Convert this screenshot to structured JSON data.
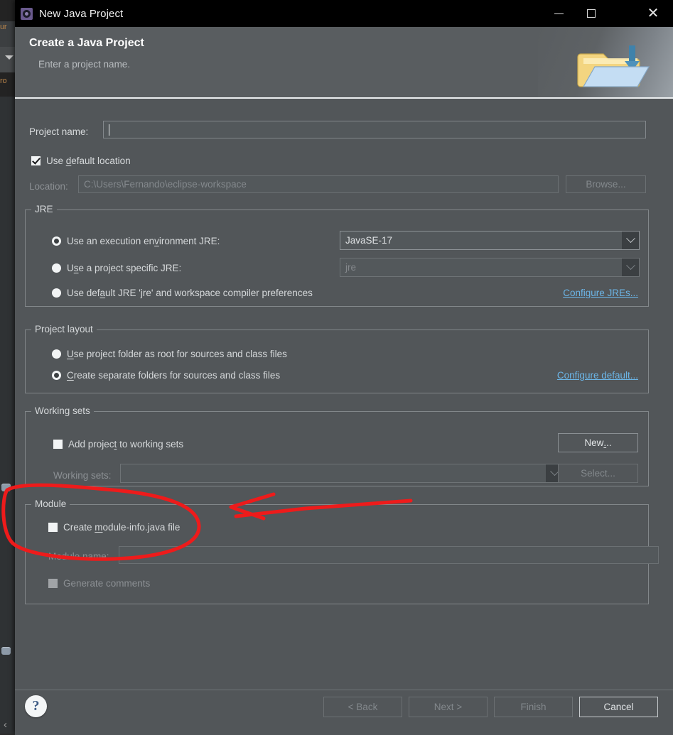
{
  "window": {
    "title": "New Java Project",
    "app_icon": "eclipse-gear-icon",
    "minimize": "—",
    "maximize": "□",
    "close": "✕"
  },
  "header": {
    "title": "Create a Java Project",
    "description": "Enter a project name.",
    "banner_icon": "new-java-project-folder-icon"
  },
  "project_name": {
    "label": "Project name:",
    "value": "",
    "placeholder": ""
  },
  "location": {
    "use_default_label": "Use default location",
    "use_default_checked": true,
    "label": "Location:",
    "value": "C:\\Users\\Fernando\\eclipse-workspace",
    "browse_label": "Browse..."
  },
  "jre": {
    "group_title": "JRE",
    "options": [
      {
        "label": "Use an execution environment JRE:",
        "selected": true
      },
      {
        "label": "Use a project specific JRE:",
        "selected": false
      },
      {
        "label": "Use default JRE 'jre' and workspace compiler preferences",
        "selected": false
      }
    ],
    "execution_env_value": "JavaSE-17",
    "project_jre_value": "jre",
    "configure_link": "Configure JREs..."
  },
  "project_layout": {
    "group_title": "Project layout",
    "options": [
      {
        "label": "Use project folder as root for sources and class files",
        "selected": false
      },
      {
        "label": "Create separate folders for sources and class files",
        "selected": true
      }
    ],
    "configure_link": "Configure default..."
  },
  "working_sets": {
    "group_title": "Working sets",
    "add_label": "Add project to working sets",
    "add_checked": false,
    "new_label": "New...",
    "sets_label": "Working sets:",
    "sets_value": "",
    "select_label": "Select..."
  },
  "module": {
    "group_title": "Module",
    "create_label": "Create module-info.java file",
    "create_checked": false,
    "name_label": "Module name:",
    "name_value": "",
    "generate_comments_label": "Generate comments",
    "generate_comments_checked": false
  },
  "footer": {
    "help_icon": "?",
    "back_label": "< Back",
    "next_label": "Next >",
    "finish_label": "Finish",
    "cancel_label": "Cancel"
  },
  "annotations": {
    "color": "#ee1b1b",
    "ellipse_target": "create-module-info-checkbox",
    "arrow_direction": "right-to-left"
  },
  "background_ide": {
    "fragment_1": "ur",
    "fragment_2": "ro",
    "chevron": "‹"
  },
  "colors": {
    "titlebar_bg": "#000000",
    "header_bg": "#595d60",
    "dialog_bg": "#525659",
    "link": "#6cb6e8",
    "annotation_red": "#ee1b1b"
  }
}
